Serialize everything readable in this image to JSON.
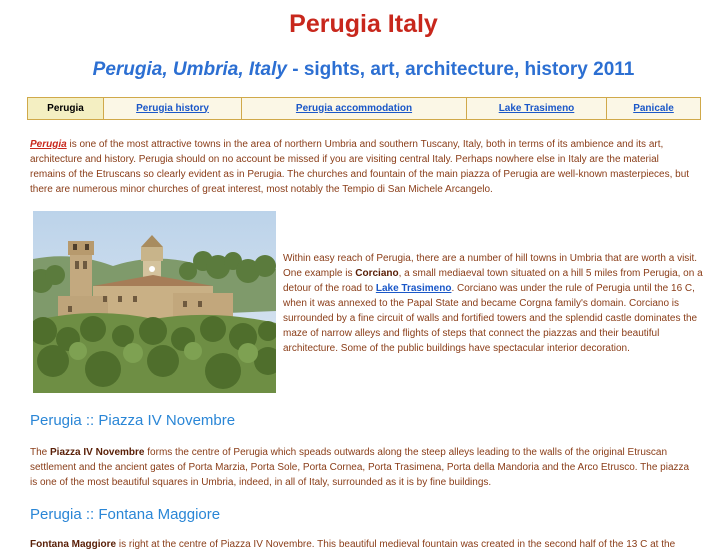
{
  "header": {
    "title": "Perugia Italy",
    "subtitle_italic": "Perugia, Umbria, Italy",
    "subtitle_rest": " - sights, art, architecture, history 2011"
  },
  "nav": {
    "items": [
      {
        "label": "Perugia",
        "current": true
      },
      {
        "label": "Perugia history",
        "current": false
      },
      {
        "label": "Perugia accommodation",
        "current": false
      },
      {
        "label": "Lake Trasimeno",
        "current": false
      },
      {
        "label": "Panicale",
        "current": false
      }
    ]
  },
  "intro": {
    "lead_link": "Perugia",
    "text": " is one of the most attractive towns in the area of northern Umbria and southern Tuscany, Italy, both in terms of its ambience and its art, architecture and history. Perugia should on no account be missed if you are visiting central Italy. Perhaps nowhere else in Italy are the material remains of the Etruscans so clearly evident as in Perugia. The churches and fountain of the main piazza of Perugia are well-known masterpieces, but there are numerous minor churches of great interest, most notably the Tempio di San Michele Arcangelo."
  },
  "corciano": {
    "text_1": "Within easy reach of Perugia, there are a number of hill towns in Umbria that are worth a visit. One example is ",
    "bold_town": "Corciano",
    "text_2": ", a small mediaeval town situated on a hill 5 miles from Perugia, on a detour of the road to ",
    "lake_link": "Lake Trasimeno",
    "text_3": ". Corciano was under the rule of Perugia until the 16 C, when it was annexed to the Papal State and became Corgna family's domain. Corciano is surrounded by a fine circuit of walls and fortified towers and the splendid castle dominates the maze of narrow alleys and flights of steps that connect the piazzas and their beautiful architecture. Some of the public buildings have spectacular interior decoration."
  },
  "section_piazza": {
    "heading": "Perugia :: Piazza IV Novembre",
    "text_1": "The ",
    "bold": "Piazza IV Novembre",
    "text_2": " forms the centre of Perugia which speads outwards along the steep alleys leading to the walls of the original Etruscan settlement and the ancient gates of Porta Marzia, Porta Sole, Porta Cornea, Porta Trasimena, Porta della Mandoria and the Arco Etrusco. The piazza is one of the most beautiful squares in Umbria, indeed, in all of Italy, surrounded as it is by fine buildings."
  },
  "section_fontana": {
    "heading": "Perugia :: Fontana Maggiore",
    "bold": "Fontana Maggiore",
    "text": " is right at the centre of Piazza IV Novembre. This beautiful medieval fountain was created in the second half of the 13 C at the"
  }
}
